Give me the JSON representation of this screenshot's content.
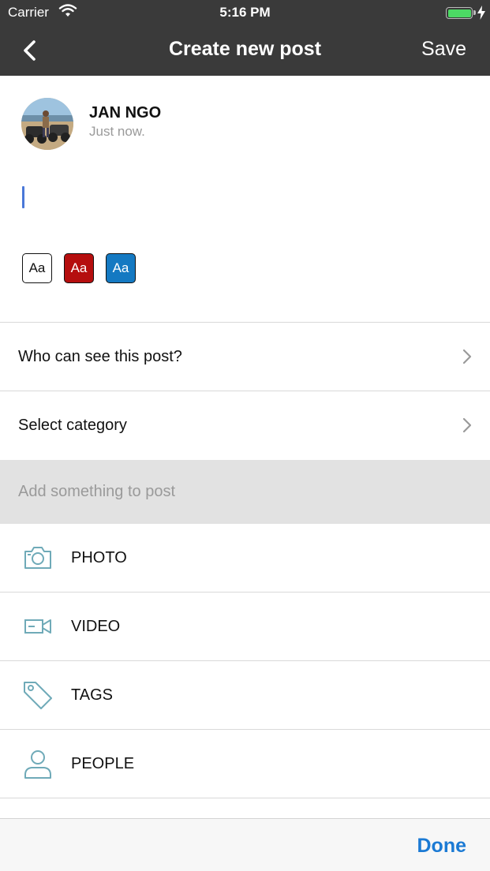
{
  "status_bar": {
    "carrier": "Carrier",
    "time": "5:16 PM"
  },
  "nav": {
    "title": "Create new post",
    "save_label": "Save"
  },
  "author": {
    "name": "JAN NGO",
    "time": "Just now."
  },
  "text_styles": [
    "Aa",
    "Aa",
    "Aa"
  ],
  "options": [
    {
      "label": "Who can see this post?"
    },
    {
      "label": "Select category"
    }
  ],
  "add_section": {
    "header": "Add something to post"
  },
  "media": [
    {
      "label": "PHOTO",
      "icon": "camera-icon"
    },
    {
      "label": "VIDEO",
      "icon": "video-icon"
    },
    {
      "label": "TAGS",
      "icon": "tag-icon"
    },
    {
      "label": "PEOPLE",
      "icon": "person-icon"
    }
  ],
  "toolbar": {
    "done_label": "Done"
  },
  "colors": {
    "bar": "#3a3a3a",
    "accent": "#1b7ad4",
    "icon": "#6faab8",
    "red_style": "#b50e0e",
    "blue_style": "#1479c2"
  }
}
